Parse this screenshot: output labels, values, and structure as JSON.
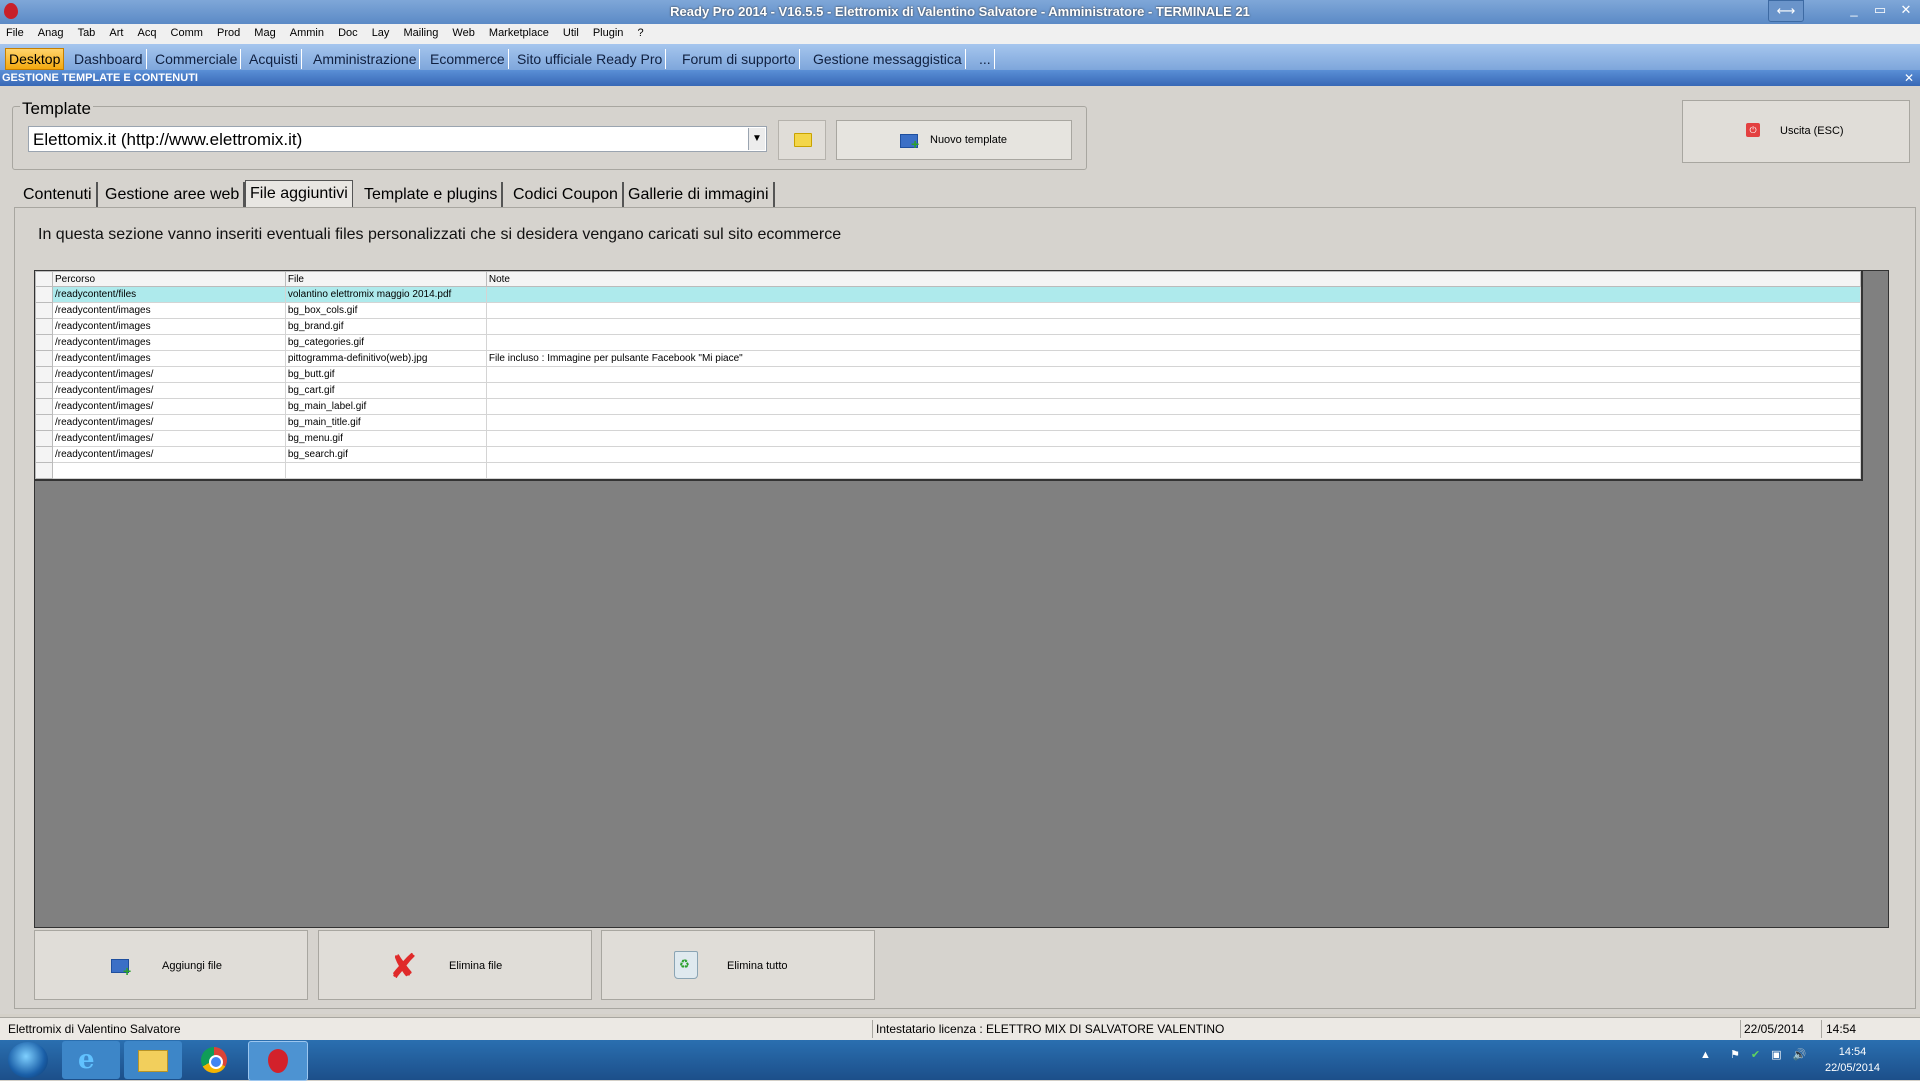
{
  "window": {
    "title": "Ready Pro 2014 - V16.5.5 - Elettromix di Valentino Salvatore - Amministratore - TERMINALE 21",
    "min": "_",
    "max": "▭",
    "close": "✕",
    "resize": "⟷"
  },
  "menubar": [
    "File",
    "Anag",
    "Tab",
    "Art",
    "Acq",
    "Comm",
    "Prod",
    "Mag",
    "Ammin",
    "Doc",
    "Lay",
    "Mailing",
    "Web",
    "Marketplace",
    "Util",
    "Plugin",
    "?"
  ],
  "navtabs": [
    "Desktop",
    "Dashboard",
    "Commerciale",
    "Acquisti",
    "Amministrazione",
    "Ecommerce",
    "Sito ufficiale Ready Pro",
    "Forum di supporto",
    "Gestione messaggistica",
    "..."
  ],
  "section": {
    "title": "GESTIONE TEMPLATE E CONTENUTI",
    "close": "✕"
  },
  "template": {
    "label": "Template",
    "selected": "Elettomix.it (http://www.elettromix.it)",
    "new_button": "Nuovo template",
    "exit_button": "Uscita (ESC)"
  },
  "tabs": [
    "Contenuti",
    "Gestione aree web",
    "File aggiuntivi",
    "Template e plugins",
    "Codici Coupon",
    "Gallerie di immagini"
  ],
  "active_tab": "File aggiuntivi",
  "info_text": "In questa sezione vanno inseriti eventuali files personalizzati che si desidera vengano caricati sul sito ecommerce",
  "grid": {
    "columns": [
      "Percorso",
      "File",
      "Note"
    ],
    "rows": [
      [
        "/readycontent/files",
        "volantino elettromix maggio 2014.pdf",
        ""
      ],
      [
        "/readycontent/images",
        "bg_box_cols.gif",
        ""
      ],
      [
        "/readycontent/images",
        "bg_brand.gif",
        ""
      ],
      [
        "/readycontent/images",
        "bg_categories.gif",
        ""
      ],
      [
        "/readycontent/images",
        "pittogramma-definitivo(web).jpg",
        "File incluso : Immagine per pulsante Facebook \"Mi piace\""
      ],
      [
        "/readycontent/images/",
        "bg_butt.gif",
        ""
      ],
      [
        "/readycontent/images/",
        "bg_cart.gif",
        ""
      ],
      [
        "/readycontent/images/",
        "bg_main_label.gif",
        ""
      ],
      [
        "/readycontent/images/",
        "bg_main_title.gif",
        ""
      ],
      [
        "/readycontent/images/",
        "bg_menu.gif",
        ""
      ],
      [
        "/readycontent/images/",
        "bg_search.gif",
        ""
      ],
      [
        "",
        "",
        ""
      ]
    ]
  },
  "buttons": {
    "add": "Aggiungi file",
    "delete": "Elimina file",
    "delete_all": "Elimina tutto"
  },
  "status": {
    "company": "Elettromix di Valentino Salvatore",
    "license": "Intestatario licenza : ELETTRO MIX DI SALVATORE VALENTINO",
    "date": "22/05/2014",
    "time": "14:54"
  },
  "taskbar": {
    "clock_time": "14:54",
    "clock_date": "22/05/2014"
  }
}
